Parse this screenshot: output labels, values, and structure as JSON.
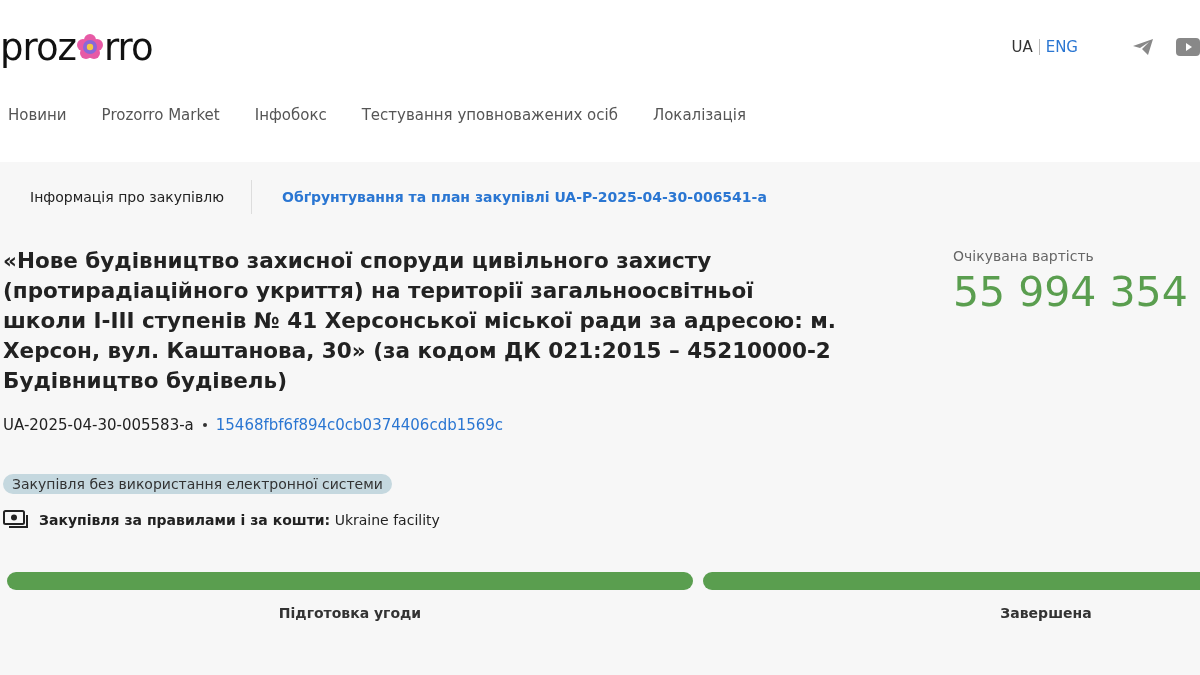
{
  "header": {
    "logo_left": "proz",
    "logo_right": "rro",
    "languages": [
      {
        "label": "UA",
        "selected": true
      },
      {
        "label": "ENG",
        "selected": false
      }
    ]
  },
  "nav": [
    "Новини",
    "Prozorro Market",
    "Інфобокс",
    "Тестування уповноважених осіб",
    "Локалізація"
  ],
  "tabs": [
    {
      "label": "Інформація про закупівлю",
      "selected": true
    },
    {
      "label": "Обґрунтування та план закупівлі UA-P-2025-04-30-006541-a",
      "selected": false
    }
  ],
  "tender": {
    "title": "«Нове будівництво захисної споруди цивільного захисту (протирадіаційного укриття) на території загальноосвітньої школи I-III ступенів № 41 Херсонської міської ради за адресою: м. Херсон, вул. Каштанова, 30» (за кодом ДК 021:2015 – 45210000-2 Будівництво будівель)",
    "id": "UA-2025-04-30-005583-a",
    "hash": "15468fbf6f894c0cb0374406cdb1569c",
    "tag": "Закупівля без використання електронної системи",
    "funding_label": "Закупівля за правилами і за кошти:",
    "funding_value": "Ukraine facility",
    "value_label": "Очікувана вартість",
    "value": "55 994 354"
  },
  "stages": [
    {
      "label": "Підготовка угоди",
      "completed": true
    },
    {
      "label": "Завершена",
      "completed": true
    }
  ]
}
